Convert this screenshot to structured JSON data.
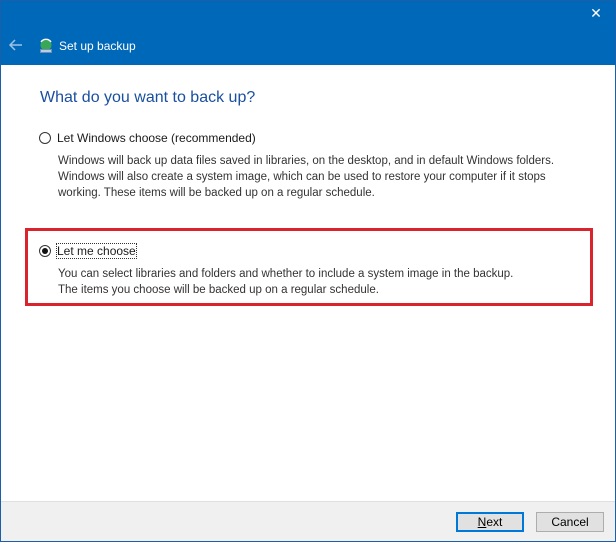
{
  "window": {
    "title": "Set up backup",
    "close_glyph": "✕",
    "back_icon": "back-arrow-icon",
    "app_icon": "backup-icon"
  },
  "main": {
    "heading": "What do you want to back up?",
    "options": [
      {
        "label": "Let Windows choose (recommended)",
        "selected": false,
        "description": [
          "Windows will back up data files saved in libraries, on the desktop, and in default Windows folders.",
          "Windows will also create a system image, which can be used to restore your computer if it stops",
          "working. These items will be backed up on a regular schedule."
        ]
      },
      {
        "label": "Let me choose",
        "selected": true,
        "description": [
          "You can select libraries and folders and whether to include a system image in the backup.",
          "The items you choose will be backed up on a regular schedule."
        ]
      }
    ]
  },
  "footer": {
    "next_first": "N",
    "next_rest": "ext",
    "cancel_label": "Cancel"
  },
  "colors": {
    "titlebar": "#0068b8",
    "heading": "#1a4fa0",
    "highlight": "#d9232d"
  }
}
